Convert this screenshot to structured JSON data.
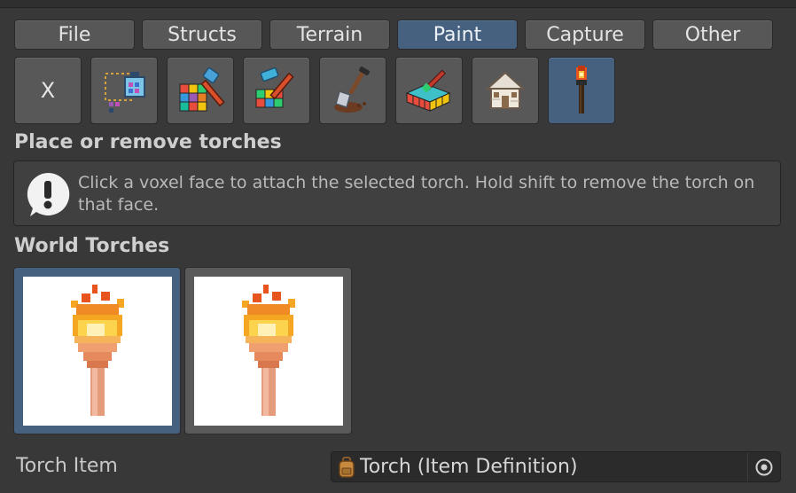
{
  "tabs": [
    {
      "label": "File",
      "active": false
    },
    {
      "label": "Structs",
      "active": false
    },
    {
      "label": "Terrain",
      "active": false
    },
    {
      "label": "Paint",
      "active": true
    },
    {
      "label": "Capture",
      "active": false
    },
    {
      "label": "Other",
      "active": false
    }
  ],
  "tools": [
    {
      "name": "clear-tool",
      "label": "X",
      "icon": "x-text",
      "active": false
    },
    {
      "name": "select-region-tool",
      "icon": "selection-blocks-icon",
      "active": false
    },
    {
      "name": "build-voxel-tool",
      "icon": "hammer-cube-icon",
      "active": false
    },
    {
      "name": "build-face-tool",
      "icon": "hammer-block-icon",
      "active": false
    },
    {
      "name": "dig-tool",
      "icon": "shovel-icon",
      "active": false
    },
    {
      "name": "paint-tool",
      "icon": "paintbrush-block-icon",
      "active": false
    },
    {
      "name": "structure-tool",
      "icon": "house-icon",
      "active": false
    },
    {
      "name": "torch-tool",
      "icon": "torch-icon",
      "active": true
    }
  ],
  "section_title": "Place or remove torches",
  "help": {
    "icon": "exclamation-icon",
    "text": "Click a voxel face to attach the selected torch. Hold shift to remove the torch on that face."
  },
  "world_torches": {
    "title": "World Torches",
    "items": [
      {
        "icon": "torch-icon",
        "selected": true
      },
      {
        "icon": "torch-icon",
        "selected": false
      }
    ]
  },
  "property": {
    "label": "Torch Item",
    "value": "Torch (Item Definition)",
    "icon": "backpack-icon",
    "picker_icon": "object-picker-icon"
  },
  "colors": {
    "background": "#383838",
    "accent": "#46607f",
    "button": "#585858"
  }
}
